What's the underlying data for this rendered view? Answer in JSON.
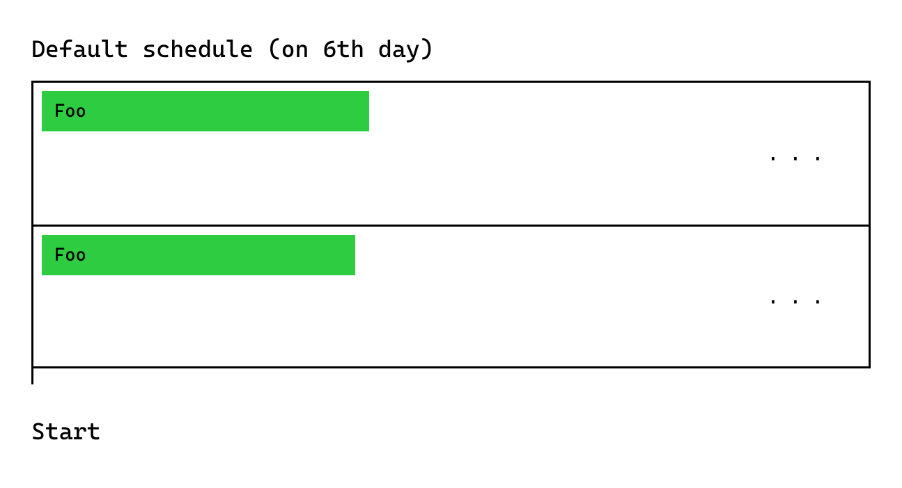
{
  "title": "Default schedule (on 6th day)",
  "rows": [
    {
      "task_label": "Foo",
      "ellipsis": "..."
    },
    {
      "task_label": "Foo",
      "ellipsis": "..."
    }
  ],
  "start_label": "Start",
  "colors": {
    "task_bar": "#2ecc40"
  }
}
